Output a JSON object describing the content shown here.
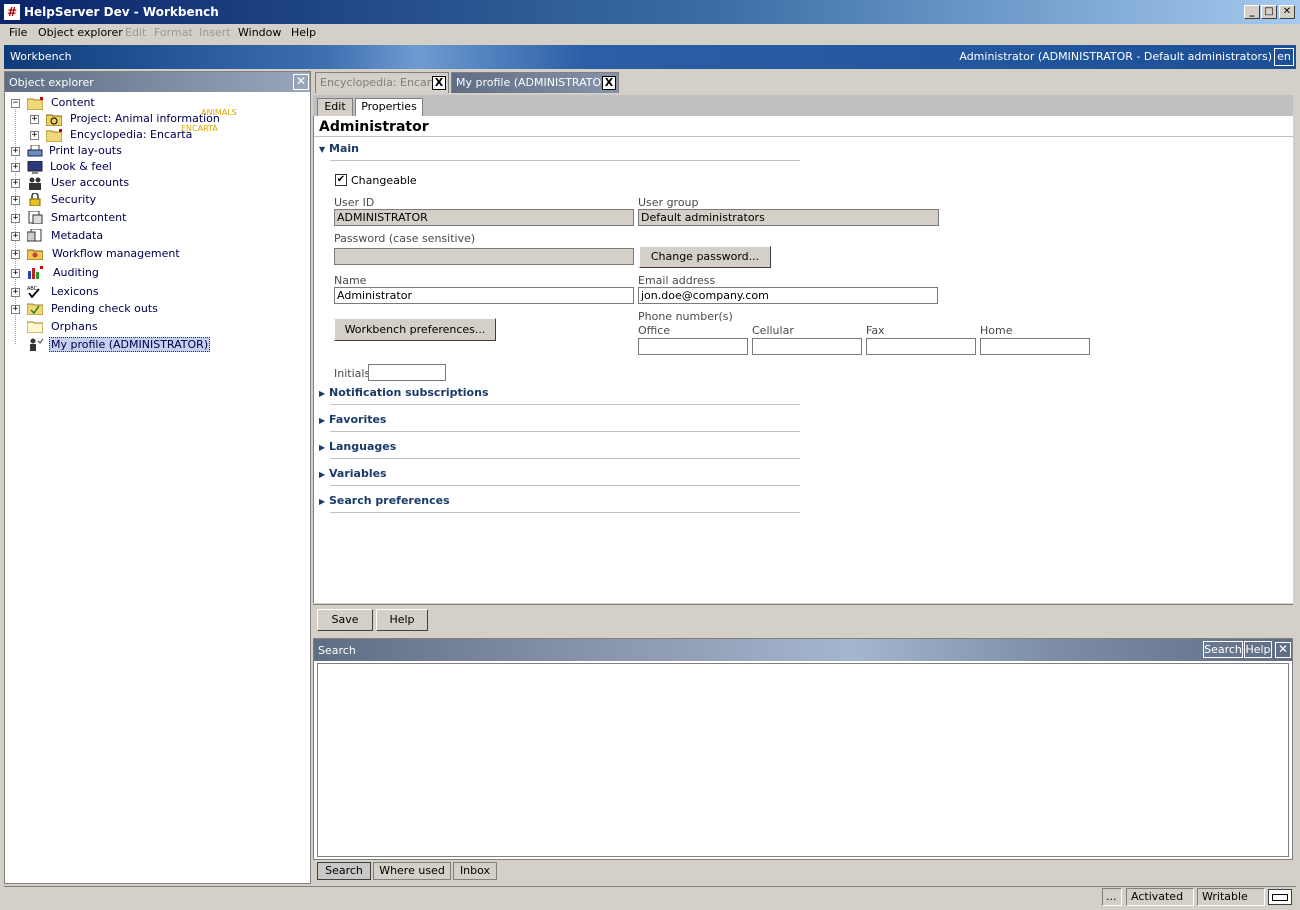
{
  "window": {
    "title": "HelpServer Dev - Workbench",
    "app_icon": "#",
    "minimize": "_",
    "maximize": "□",
    "close": "✕"
  },
  "menu": {
    "items": [
      {
        "label": "File",
        "enabled": true
      },
      {
        "label": "Object explorer",
        "enabled": true
      },
      {
        "label": "Edit",
        "enabled": false
      },
      {
        "label": "Format",
        "enabled": false
      },
      {
        "label": "Insert",
        "enabled": false
      },
      {
        "label": "Window",
        "enabled": true
      },
      {
        "label": "Help",
        "enabled": true
      }
    ]
  },
  "workbench_bar": {
    "title": "Workbench",
    "user": "Administrator (ADMINISTRATOR - Default administrators)",
    "language": "en"
  },
  "object_explorer": {
    "title": "Object explorer",
    "close": "✕",
    "tree": [
      {
        "label": "Content",
        "expanded": true,
        "level": 0,
        "icon": "content-folder-icon"
      },
      {
        "label": "Project: Animal information",
        "tag": "ANIMALS",
        "level": 1,
        "icon": "project-folder-icon"
      },
      {
        "label": "Encyclopedia: Encarta",
        "tag": "ENCARTA",
        "level": 1,
        "icon": "encyclopedia-folder-icon"
      },
      {
        "label": "Print lay-outs",
        "level": 0,
        "icon": "printer-icon"
      },
      {
        "label": "Look & feel",
        "level": 0,
        "icon": "monitor-icon"
      },
      {
        "label": "User accounts",
        "level": 0,
        "icon": "users-icon"
      },
      {
        "label": "Security",
        "level": 0,
        "icon": "lock-icon"
      },
      {
        "label": "Smartcontent",
        "level": 0,
        "icon": "smartcontent-icon"
      },
      {
        "label": "Metadata",
        "level": 0,
        "icon": "metadata-icon"
      },
      {
        "label": "Workflow management",
        "level": 0,
        "icon": "workflow-icon"
      },
      {
        "label": "Auditing",
        "level": 0,
        "icon": "chart-icon"
      },
      {
        "label": "Lexicons",
        "level": 0,
        "icon": "spellcheck-icon"
      },
      {
        "label": "Pending check outs",
        "level": 0,
        "icon": "checkout-icon"
      },
      {
        "label": "Orphans",
        "level": 0,
        "icon": "orphans-icon"
      },
      {
        "label": "My profile (ADMINISTRATOR)",
        "level": 0,
        "icon": "profile-icon",
        "selected": true
      }
    ]
  },
  "doc_tabs": [
    {
      "label": "Encyclopedia: Encarta",
      "active": false,
      "close": "X"
    },
    {
      "label": "My profile (ADMINISTRATOR)",
      "active": true,
      "close": "X"
    }
  ],
  "sub_tabs": [
    {
      "label": "Edit",
      "active": false
    },
    {
      "label": "Properties",
      "active": true
    }
  ],
  "properties": {
    "heading": "Administrator",
    "main_section": "Main",
    "changeable": {
      "label": "Changeable",
      "checked": true,
      "mark": "✔"
    },
    "user_id": {
      "label": "User ID",
      "value": "ADMINISTRATOR"
    },
    "user_group": {
      "label": "User group",
      "value": "Default administrators"
    },
    "password": {
      "label": "Password (case sensitive)",
      "value": ""
    },
    "change_password_button": "Change password...",
    "name": {
      "label": "Name",
      "value": "Administrator"
    },
    "email": {
      "label": "Email address",
      "value": "jon.doe@company.com"
    },
    "workbench_prefs_button": "Workbench preferences...",
    "phone": {
      "label": "Phone number(s)",
      "office": "Office",
      "cellular": "Cellular",
      "fax": "Fax",
      "home": "Home"
    },
    "initials": {
      "label": "Initials",
      "value": ""
    },
    "collapsed_sections": [
      "Notification subscriptions",
      "Favorites",
      "Languages",
      "Variables",
      "Search preferences"
    ]
  },
  "actions": {
    "save": "Save",
    "help": "Help"
  },
  "search_panel": {
    "title": "Search",
    "search_button": "Search",
    "help_button": "Help",
    "close": "✕"
  },
  "bottom_tabs": [
    {
      "label": "Search",
      "active": true
    },
    {
      "label": "Where used",
      "active": false
    },
    {
      "label": "Inbox",
      "active": false
    }
  ],
  "status": {
    "ellipsis": "...",
    "activated": "Activated",
    "writable": "Writable"
  }
}
